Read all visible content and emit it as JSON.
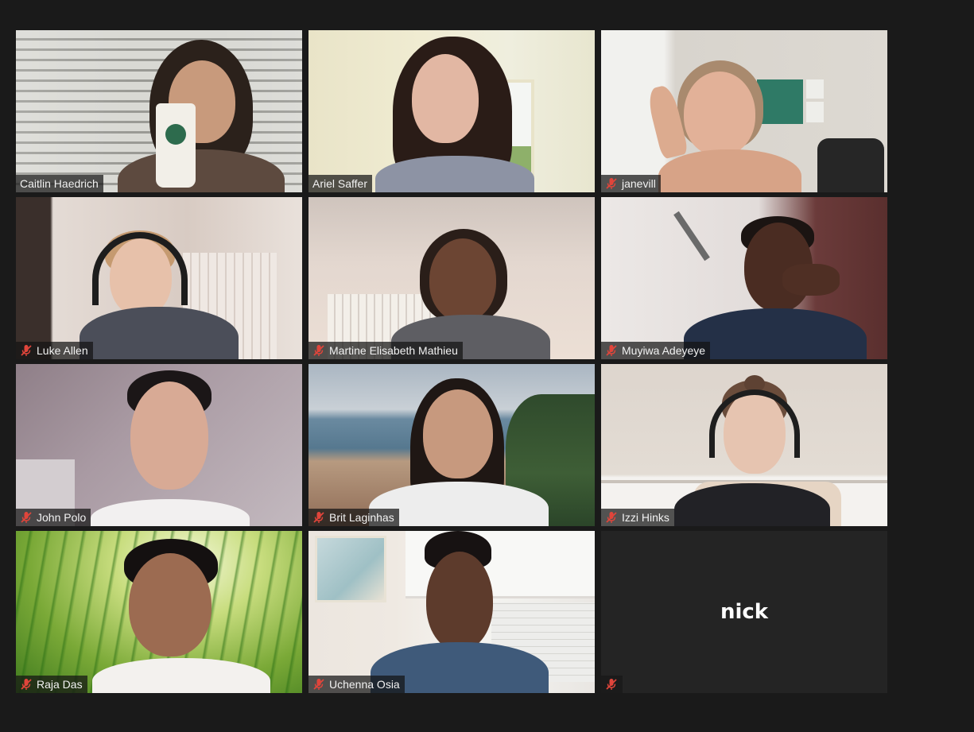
{
  "participants": [
    {
      "name": "Caitlin Haedrich",
      "muted": false,
      "active": false
    },
    {
      "name": "Ariel Saffer",
      "muted": false,
      "active": true
    },
    {
      "name": "janevill",
      "muted": true,
      "active": false
    },
    {
      "name": "Luke Allen",
      "muted": true,
      "active": false
    },
    {
      "name": "Martine Elisabeth Mathieu",
      "muted": true,
      "active": false
    },
    {
      "name": "Muyiwa Adeyeye",
      "muted": true,
      "active": false
    },
    {
      "name": "John Polo",
      "muted": true,
      "active": false
    },
    {
      "name": "Brit Laginhas",
      "muted": true,
      "active": false
    },
    {
      "name": "Izzi Hinks",
      "muted": true,
      "active": false
    },
    {
      "name": "Raja Das",
      "muted": true,
      "active": false
    },
    {
      "name": "Uchenna Osia",
      "muted": true,
      "active": false
    },
    {
      "name": "",
      "display_name": "nick",
      "muted": true,
      "active": false,
      "video_off": true
    }
  ],
  "colors": {
    "background": "#1a1a1a",
    "active_speaker_border": "#e3ec82",
    "mute_icon": "#e0453b",
    "empty_tile": "#242424"
  },
  "icons": {
    "muted": "muted-microphone-icon"
  }
}
